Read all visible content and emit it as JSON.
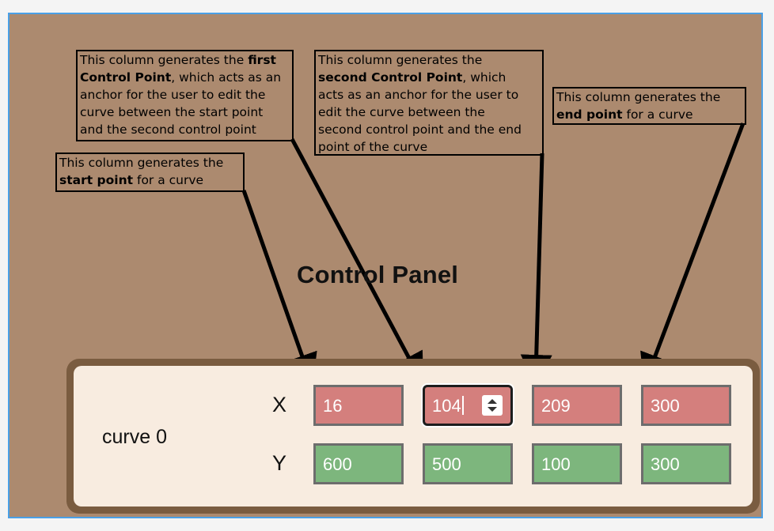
{
  "annotations": {
    "start_point": {
      "prefix": "This column generates the",
      "bold": "start point",
      "suffix": "for a curve"
    },
    "first_control": {
      "prefix": "This column generates the",
      "bold1": "first",
      "bold2": "Control Point",
      "line2_rest": ", which acts as an",
      "line3": "anchor for the user to edit the",
      "line4": "curve between the start point",
      "line5": "and the second control point"
    },
    "second_control": {
      "line1": "This column generates the",
      "bold": "second Control Point",
      "line2_rest": ", which",
      "line3": "acts as an anchor for the user to",
      "line4": "edit the curve between the",
      "line5": "second control point and the end",
      "line6": "point of the curve"
    },
    "end_point": {
      "prefix": "This column generates the",
      "bold": "end point",
      "suffix": "for a curve"
    }
  },
  "control_panel": {
    "title": "Control Panel",
    "curve_label": "curve 0",
    "x_label": "X",
    "y_label": "Y",
    "x_values": [
      "16",
      "104",
      "209",
      "300"
    ],
    "y_values": [
      "600",
      "500",
      "100",
      "300"
    ],
    "focused_field": "x_values.1"
  },
  "colors": {
    "background": "#ac8a6f",
    "panel_border": "#7a5c40",
    "panel_fill": "#f8ece0",
    "x_field": "#d47f7d",
    "y_field": "#7db67d"
  }
}
